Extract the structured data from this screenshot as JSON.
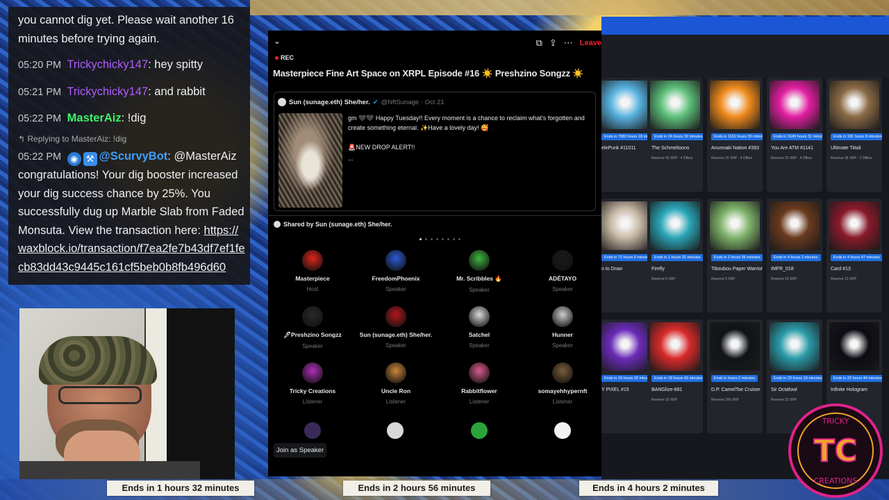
{
  "chat": {
    "intro_text": "you cannot dig yet. Please wait another 16 minutes before trying again.",
    "messages": [
      {
        "time": "05:20 PM",
        "user": "Trickychicky147",
        "text": ": hey spitty"
      },
      {
        "time": "05:21 PM",
        "user": "Trickychicky147",
        "text": ": and rabbit"
      },
      {
        "time": "05:22 PM",
        "user": "MasterAiz",
        "text": ": !dig"
      }
    ],
    "reply": {
      "context": "Replying to MasterAiz: !dig",
      "time": "05:22 PM",
      "user": "@ScurvyBot",
      "text": ": @MasterAiz congratulations! Your dig booster increased your dig success chance by 25%. You successfully dug up Marble Slab from Faded Monsuta. View the transaction here:",
      "link": "https://waxblock.io/transaction/f7ea2fe7b43df7ef1fecb83dd43c9445c161cf5beb0b8fb496d60"
    }
  },
  "space": {
    "rec_label": "REC",
    "leave_label": "Leave",
    "title": "Masterpiece Fine Art Space on XRPL Episode #16 ☀️ Preshzino Songzz ☀️",
    "tweet": {
      "author": "Sun (sunage.eth) She/her.",
      "handle": "@NftSunage · Oct 21",
      "body": "gm 🖤🖤 Happy Tuesday!! Every moment is a chance to reclaim what's forgotten and create something eternal. ✨Have a lovely day! 🥰",
      "drop": "🚨NEW DROP ALERT!!",
      "more": "..."
    },
    "shared_by": "Shared by Sun (sunage.eth) She/her.",
    "participants": [
      {
        "name": "Masterpiece",
        "role": "Host",
        "color": "#e0241b"
      },
      {
        "name": "FreedomPhoenix",
        "role": "Speaker",
        "color": "#2c5bd6"
      },
      {
        "name": "Mr. Scribbles 🔥",
        "role": "Speaker",
        "color": "#3fb63f"
      },
      {
        "name": "ADÉTAYO",
        "role": "Speaker",
        "color": "#1a1a1a"
      },
      {
        "name": "🖊Preshzino Songzz",
        "role": "Speaker",
        "color": "#2a2a2a"
      },
      {
        "name": "Sun (sunage.eth) She/her.",
        "role": "Speaker",
        "color": "#b3151c"
      },
      {
        "name": "Satchel",
        "role": "Speaker",
        "color": "#d9d9d9"
      },
      {
        "name": "Hunner",
        "role": "Speaker",
        "color": "#cfcfcf"
      },
      {
        "name": "Tricky Creations",
        "role": "Listener",
        "color": "#b02fb8"
      },
      {
        "name": "Uncle Ron",
        "role": "Listener",
        "color": "#c9863a"
      },
      {
        "name": "Rabbitflower",
        "role": "Listener",
        "color": "#d85a8e"
      },
      {
        "name": "somayehhypernft",
        "role": "Listener",
        "color": "#7a5c3a"
      }
    ],
    "join_label": "Join as Speaker"
  },
  "market": {
    "cards": [
      {
        "ends": "Ends in 7083 hours 18 minutes",
        "name": "elePunk #11011",
        "meta": "",
        "color": "#57b2e0"
      },
      {
        "ends": "Ends in 24 hours 32 minutes",
        "name": "The Schmeltoons",
        "meta": "Reserve 50 XRP · 4 Offers",
        "color": "#5ec07a"
      },
      {
        "ends": "Ends in 1151 hours 35 minutes",
        "name": "Anunnaki Nation #393",
        "meta": "Reserve 15 XRP · 4 Offers",
        "color": "#f08a1c"
      },
      {
        "ends": "Ends in 1649 hours 31 minutes",
        "name": "You Are ATM #1141",
        "meta": "Reserve 20 XRP · 4 Offers",
        "color": "#e21fa0"
      },
      {
        "ends": "Ends in 181 hours 8 minutes",
        "name": "Ultimate Tiitali",
        "meta": "Reserve 36 XRP · 2 Offers",
        "color": "#8a6a45"
      },
      {
        "ends": "Ends in 72 hours 6 minutes",
        "name": "n to Draw",
        "meta": "",
        "color": "#c9b9a6"
      },
      {
        "ends": "Ends in 1 hours 32 minutes",
        "name": "Firefly",
        "meta": "Reserve 6 XRP",
        "color": "#2aa6b8"
      },
      {
        "ends": "Ends in 2 hours 56 minutes",
        "name": "Tiboubou Paper Warrior",
        "meta": "Reserve 5 XRP",
        "color": "#7fb36a"
      },
      {
        "ends": "Ends in 4 hours 2 minutes",
        "name": "IMFR_018",
        "meta": "Reserve 10 XRP",
        "color": "#6b3a1e"
      },
      {
        "ends": "Ends in 4 hours 47 minutes",
        "name": "Card #13",
        "meta": "Reserve 10 XRP",
        "color": "#8a1a2a"
      },
      {
        "ends": "Ends in 19 hours 32 minutes",
        "name": "Y PIXEL #15",
        "meta": "",
        "color": "#6a2bb8"
      },
      {
        "ends": "Ends in 18 hours 42 minutes",
        "name": "BANGlize-681",
        "meta": "Reserve 10 XRP",
        "color": "#d82a2a"
      },
      {
        "ends": "Ends in hours 2 minutes",
        "name": "D.P. CamelToe Cruiser",
        "meta": "Reserve 200 XRP",
        "color": "#111418"
      },
      {
        "ends": "Ends in 23 hours 16 minutes",
        "name": "Sir Octafowl",
        "meta": "Reserve 25 XRP",
        "color": "#2a9aa8"
      },
      {
        "ends": "Ends in 22 hours 44 minutes",
        "name": "Infinite Hologram",
        "meta": "",
        "color": "#0c0c14"
      }
    ]
  },
  "auctions": [
    {
      "label": "Ends in 1 hours 32 minutes"
    },
    {
      "label": "Ends in 2 hours 56 minutes"
    },
    {
      "label": "Ends in 4 hours 2 minutes"
    }
  ],
  "logo": {
    "text": "TRICKY CREATIONS",
    "initials": "TC",
    "accent": "#e0228a",
    "color2": "#f0a52a"
  }
}
